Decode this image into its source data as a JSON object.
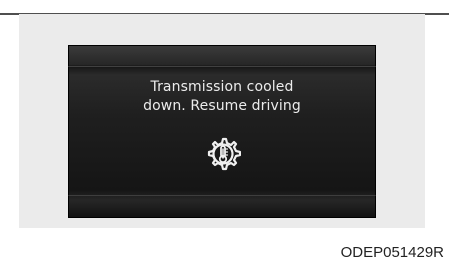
{
  "display": {
    "message_line_1": "Transmission cooled",
    "message_line_2": "down. Resume driving",
    "icon": "transmission-temperature-gear-icon"
  },
  "figure": {
    "code": "ODEP051429R"
  },
  "colors": {
    "screen_background": "#1f1f1f",
    "screen_text": "#ececec",
    "page_background": "#ebebeb",
    "rule": "#4f4f4f"
  }
}
